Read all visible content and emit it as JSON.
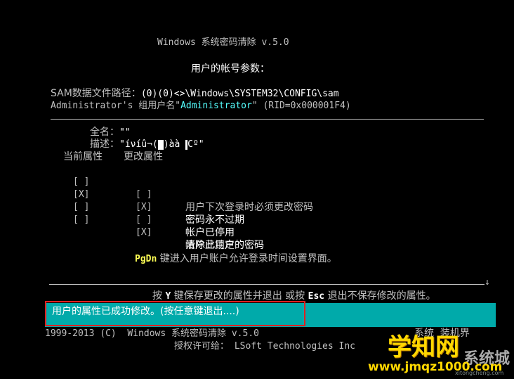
{
  "header": {
    "title": "Windows 系统密码清除 v.5.0",
    "subtitle": "用户的帐号参数："
  },
  "account": {
    "sam_label": "SAM数据文件路径：",
    "sam_path": "(0)(0)<>\\Windows\\SYSTEM32\\CONFIG\\sam",
    "group_label_prefix": "Administrator's 组用户名\"",
    "group_name": "Administrator",
    "group_label_suffix": "\" (RID=0x000001F4)"
  },
  "details": {
    "fullname_label": "全名：",
    "fullname_value": "\"\"",
    "desc_label": "描述：",
    "desc_value_a": "\"íνíû¬(",
    "desc_value_b": ")àà ",
    "desc_value_c": "Cº\""
  },
  "attributes": {
    "current_header": "当前属性",
    "change_header": "更改属性",
    "rows": [
      {
        "current": "[ ]",
        "change": "[ ]",
        "label": "用户下次登录时必须更改密码"
      },
      {
        "current": "[X]",
        "change": "[X]",
        "label": "密码永不过期"
      },
      {
        "current": "[ ]",
        "change": "[ ]",
        "label": "帐户已停用"
      },
      {
        "current": "[ ]",
        "change": "[ ]",
        "label": "帐户已锁定"
      },
      {
        "current": "",
        "change": "[X]",
        "label": "清除此用户的密码"
      }
    ]
  },
  "pgdn": {
    "key": "PgDn",
    "text": " 键进入用户账户允许登录时间设置界面。"
  },
  "footer_hint": {
    "press": "按 ",
    "y_key": "Y",
    "mid": " 键保存更改的属性并退出 或按 ",
    "esc_key": "Esc",
    "end": " 退出不保存修改的属性。",
    "arrow": "↓"
  },
  "status": {
    "message": "用户的属性已成功修改。(按任意键退出....)"
  },
  "copyright": {
    "line1": "1999-2013 (C)  Windows 系统密码清除 v.5.0",
    "line2": "授权许可给： LSoft Technologies Inc",
    "trailing": "系统  装机界"
  },
  "watermark": {
    "main": "学知网",
    "url": "www.jmqz1000.com",
    "sys": "系统城",
    "sys_sub": "xitongcheng.com"
  }
}
